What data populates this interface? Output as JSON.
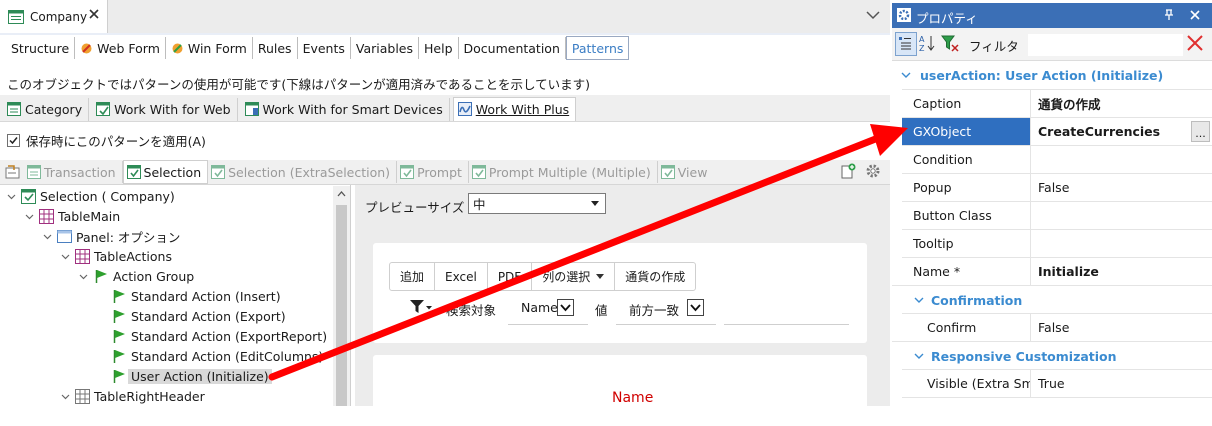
{
  "document_tab": {
    "title": "Company"
  },
  "designer_tabs": [
    {
      "label": "Structure",
      "icon": "none"
    },
    {
      "label": "Web Form",
      "icon": "webform-icon"
    },
    {
      "label": "Win Form",
      "icon": "winform-icon"
    },
    {
      "label": "Rules",
      "icon": "none"
    },
    {
      "label": "Events",
      "icon": "none"
    },
    {
      "label": "Variables",
      "icon": "none"
    },
    {
      "label": "Help",
      "icon": "none"
    },
    {
      "label": "Documentation",
      "icon": "none"
    },
    {
      "label": "Patterns",
      "icon": "none",
      "active": true
    }
  ],
  "info_text": "このオブジェクトではパターンの使用が可能です(下線はパターンが適用済みであることを示しています)",
  "pattern_tabs": [
    {
      "label": "Category"
    },
    {
      "label": "Work With for Web"
    },
    {
      "label": "Work With for Smart Devices"
    },
    {
      "label": "Work With Plus",
      "active": true
    }
  ],
  "apply_checkbox": {
    "label": "保存時にこのパターンを適用(A)",
    "checked": true
  },
  "instance_tabs": [
    {
      "label": "Transaction"
    },
    {
      "label": "Selection",
      "active": true
    },
    {
      "label": "Selection (ExtraSelection)"
    },
    {
      "label": "Prompt"
    },
    {
      "label": "Prompt Multiple (Multiple)"
    },
    {
      "label": "View"
    }
  ],
  "tree": [
    {
      "label": "Selection ( Company)",
      "icon": "selection-icon"
    },
    {
      "label": "TableMain",
      "icon": "table-icon"
    },
    {
      "label": "Panel: オプション",
      "icon": "panel-icon"
    },
    {
      "label": "TableActions",
      "icon": "table-icon"
    },
    {
      "label": "Action Group",
      "icon": "flag-icon"
    },
    {
      "label": "Standard Action (Insert)",
      "icon": "flag-icon"
    },
    {
      "label": "Standard Action (Export)",
      "icon": "flag-icon"
    },
    {
      "label": "Standard Action (ExportReport)",
      "icon": "flag-icon"
    },
    {
      "label": "Standard Action (EditColumns)",
      "icon": "flag-icon"
    },
    {
      "label": "User Action (Initialize)",
      "icon": "flag-icon",
      "selected": true
    },
    {
      "label": "TableRightHeader",
      "icon": "table-gray-icon"
    }
  ],
  "preview": {
    "size_label": "プレビューサイズ",
    "size_value": "中",
    "buttons": [
      "追加",
      "Excel",
      "PDF",
      "列の選択",
      "通貨の作成"
    ],
    "filter_label": "検索対象",
    "filter_field": "Name",
    "value_label": "値",
    "match_mode": "前方一致",
    "grid_header": "Name"
  },
  "properties": {
    "title": "プロパティ",
    "filter_label": "フィルタ",
    "filter_value": "",
    "category_main": "userAction: User Action (Initialize)",
    "rows_main": [
      {
        "name": "Caption",
        "value": "通貨の作成",
        "bold": true
      },
      {
        "name": "GXObject",
        "value": "CreateCurrencies",
        "bold": true,
        "selected": true
      },
      {
        "name": "Condition",
        "value": ""
      },
      {
        "name": "Popup",
        "value": "False"
      },
      {
        "name": "Button Class",
        "value": ""
      },
      {
        "name": "Tooltip",
        "value": ""
      },
      {
        "name": "Name *",
        "value": "Initialize",
        "bold": true
      }
    ],
    "category_confirmation": "Confirmation",
    "confirm_row": {
      "name": "Confirm",
      "value": "False"
    },
    "category_responsive": "Responsive Customization",
    "visible_row": {
      "name": "Visible (Extra Sm",
      "value": "True"
    }
  },
  "colors": {
    "properties_title_bg": "#3b6fb6",
    "selection_blue": "#2f6fc0",
    "category_text": "#3b8bd0",
    "arrow_red": "#ff0000",
    "grid_header_red": "#d00000"
  }
}
